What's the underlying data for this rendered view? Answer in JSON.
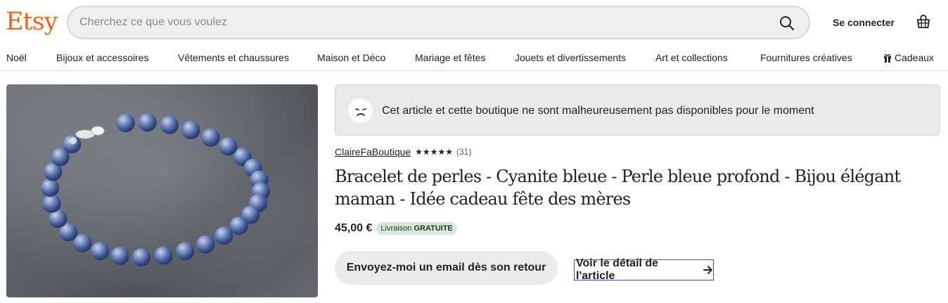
{
  "header": {
    "logo": "Etsy",
    "search_placeholder": "Cherchez ce que vous voulez",
    "signin_label": "Se connecter"
  },
  "nav": {
    "items": [
      {
        "label": "Noël"
      },
      {
        "label": "Bijoux et accessoires"
      },
      {
        "label": "Vêtements et chaussures"
      },
      {
        "label": "Maison et Déco"
      },
      {
        "label": "Mariage et fêtes"
      },
      {
        "label": "Jouets et divertissements"
      },
      {
        "label": "Art et collections"
      },
      {
        "label": "Fournitures créatives"
      },
      {
        "label": "Cadeaux",
        "icon": "gift-icon"
      }
    ]
  },
  "banner": {
    "icon": "sad-face-icon",
    "text": "Cet article et cette boutique ne sont malheureusement pas disponibles pour le moment"
  },
  "listing": {
    "shop_name": "ClaireFaBoutique",
    "stars": "★★★★★",
    "rating": 5,
    "review_count": "(31)",
    "title": "Bracelet de perles - Cyanite bleue - Perle bleue profond - Bijou élégant maman - Idée cadeau fête des mères",
    "price": "45,00 €",
    "shipping_prefix": "Livraison",
    "shipping_free": "GRATUITE",
    "email_button": "Envoyez-moi un email dès son retour",
    "detail_link": "Voir le détail de l'article"
  },
  "colors": {
    "brand": "#F1641E",
    "banner_bg": "#eaeaea",
    "badge_bg": "#d4e9d7"
  }
}
